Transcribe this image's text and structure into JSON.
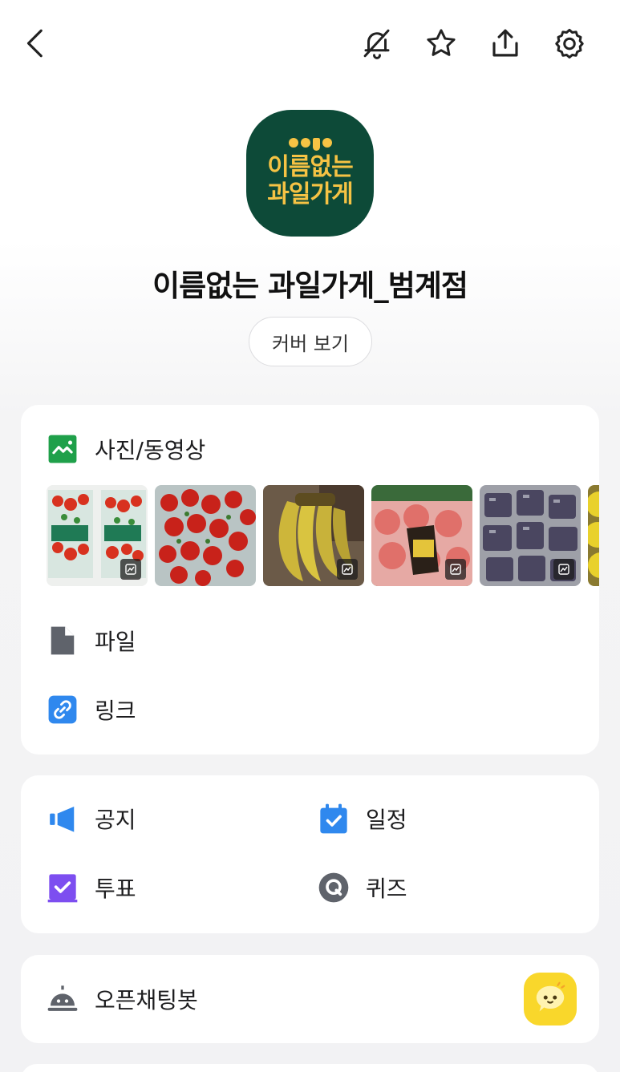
{
  "header": {
    "back_icon": "chevron-left-icon",
    "actions": [
      "bell-off-icon",
      "star-icon",
      "share-icon",
      "gear-icon"
    ]
  },
  "profile": {
    "logo_line1": "이름없는",
    "logo_line2": "과일가게",
    "room_name": "이름없는 과일가게_범계점",
    "cover_button": "커버 보기"
  },
  "media_section": {
    "photos_label": "사진/동영상",
    "thumbnails": [
      {
        "subject": "strawberry boxes",
        "video": true
      },
      {
        "subject": "strawberries",
        "video": false
      },
      {
        "subject": "bananas",
        "video": true
      },
      {
        "subject": "apples",
        "video": true
      },
      {
        "subject": "grapes",
        "video": true
      },
      {
        "subject": "lemons",
        "video": false
      }
    ],
    "files_label": "파일",
    "links_label": "링크"
  },
  "tools_section": {
    "notice_label": "공지",
    "schedule_label": "일정",
    "poll_label": "투표",
    "quiz_label": "퀴즈"
  },
  "bot_section": {
    "label": "오픈채팅봇"
  },
  "colors": {
    "logo_bg": "#0d4a38",
    "logo_text": "#f6c344",
    "accent_green": "#1fa04a",
    "accent_blue": "#2f88ee",
    "accent_purple": "#7d4ef0",
    "bot_yellow": "#f9d72b"
  }
}
